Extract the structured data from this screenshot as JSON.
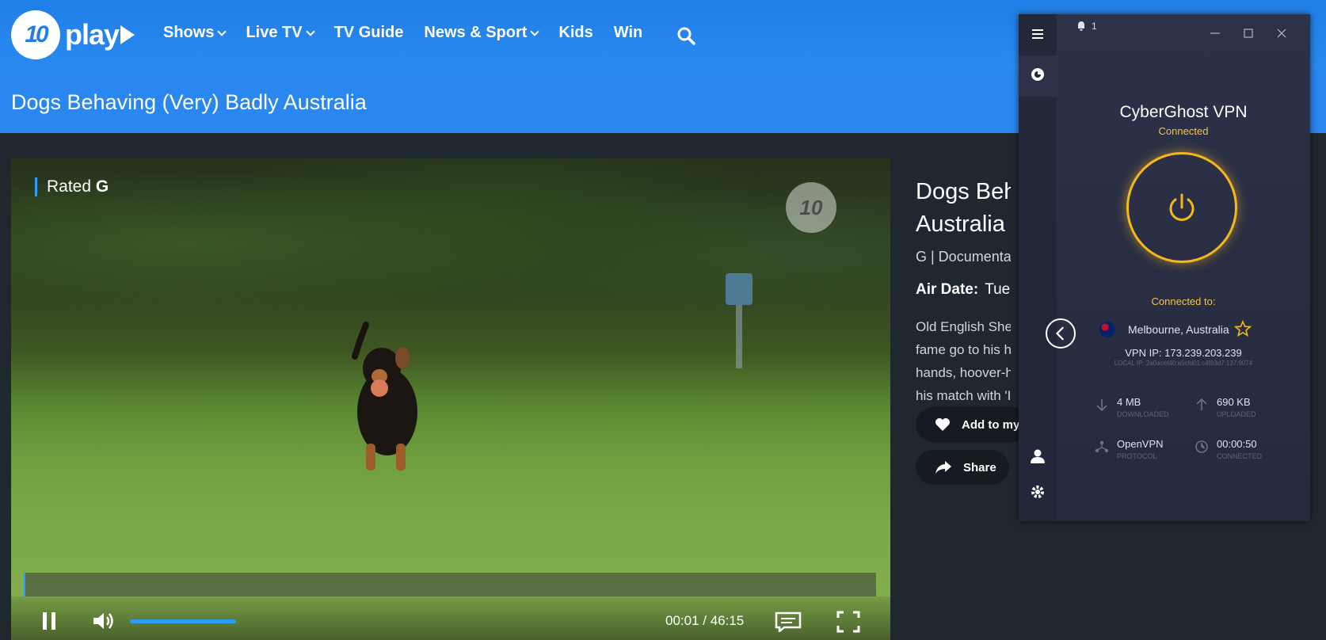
{
  "nav": {
    "logo_mark": "10",
    "logo_text": "play",
    "items": [
      "Shows",
      "Live TV",
      "TV Guide",
      "News & Sport",
      "Kids",
      "Win"
    ]
  },
  "show": {
    "title": "Dogs Behaving (Very) Badly Australia",
    "info_title_line1": "Dogs Beh",
    "info_title_line2": "Australia",
    "meta": "G  |  Documenta",
    "air_date_label": "Air Date:",
    "air_date_value": "Tue",
    "description_lines": [
      "Old English Shee",
      "fame go to his he",
      "hands, hoover-h",
      "his match with 'I"
    ],
    "add_label": "Add to my",
    "share_label": "Share"
  },
  "player": {
    "rated_prefix": "Rated",
    "rating": "G",
    "watermark": "10",
    "current_time": "00:01",
    "duration": "46:15",
    "time_display": "00:01 / 46:15",
    "volume_level": 1.0,
    "progress": 0.0004
  },
  "vpn": {
    "notifications": "1",
    "app_name": "CyberGhost VPN",
    "status": "Connected",
    "connected_to_label": "Connected to:",
    "location": "Melbourne, Australia",
    "vpn_ip": "VPN IP: 173.239.203.239",
    "local_ip": "LOCAL IP: 2a0acef40:a5cfd01:c4f83d7:137:9074",
    "downloaded": "4 MB",
    "downloaded_label": "DOWNLOADED",
    "uploaded": "690 KB",
    "uploaded_label": "UPLOADED",
    "protocol": "OpenVPN",
    "protocol_label": "PROTOCOL",
    "connected_time": "00:00:50",
    "connected_label": "CONNECTED",
    "accent": "#f4b81a"
  },
  "colors": {
    "brand_blue": "#2b87f0",
    "accent_blue": "#2b9cf7"
  }
}
